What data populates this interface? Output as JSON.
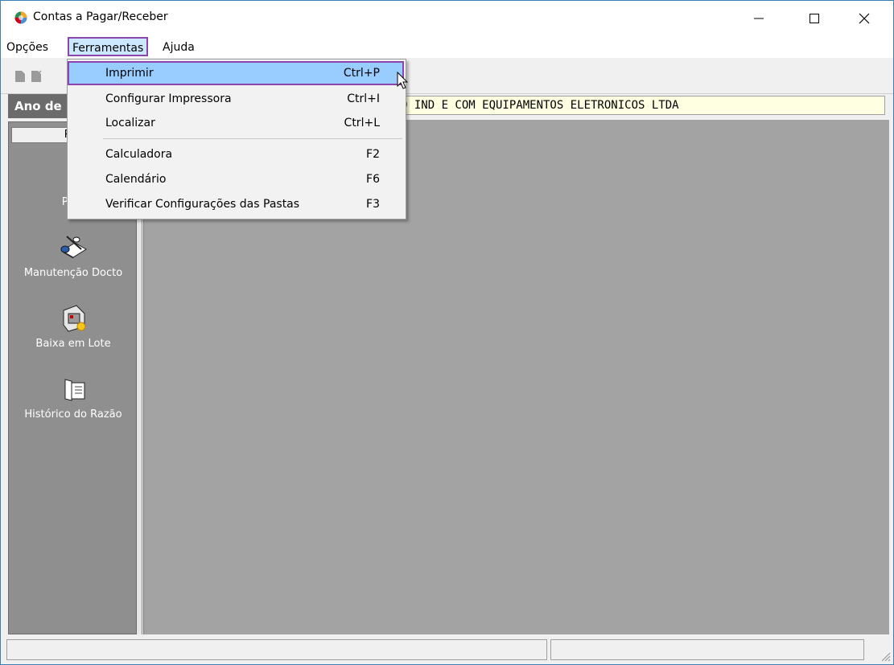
{
  "window": {
    "title": "Contas a Pagar/Receber",
    "accent_color": "#8e44ad"
  },
  "menubar": {
    "items": [
      {
        "label": "Opções"
      },
      {
        "label": "Ferramentas",
        "state": "open"
      },
      {
        "label": "Ajuda"
      }
    ]
  },
  "dropdown": {
    "items": [
      {
        "label": "Imprimir",
        "shortcut": "Ctrl+P",
        "highlighted": true
      },
      {
        "label": "Configurar Impressora",
        "shortcut": "Ctrl+I"
      },
      {
        "label": "Localizar",
        "shortcut": "Ctrl+L"
      },
      {
        "label": "Calculadora",
        "shortcut": "F2"
      },
      {
        "label": "Calendário",
        "shortcut": "F6"
      },
      {
        "label": "Verificar Configurações das Pastas",
        "shortcut": "F3"
      }
    ]
  },
  "info": {
    "ano_label": "Ano de",
    "company": "O IND E COM EQUIPAMENTOS ELETRONICOS LTDA"
  },
  "sidebar": {
    "tab_label": "Pro",
    "items": [
      {
        "label": "Parâ",
        "icon": "parameters-icon"
      },
      {
        "label": "Manutenção Docto",
        "icon": "document-maintenance-icon"
      },
      {
        "label": "Baixa em Lote",
        "icon": "batch-writeoff-icon"
      },
      {
        "label": "Histórico do Razão",
        "icon": "ledger-history-icon"
      }
    ]
  }
}
